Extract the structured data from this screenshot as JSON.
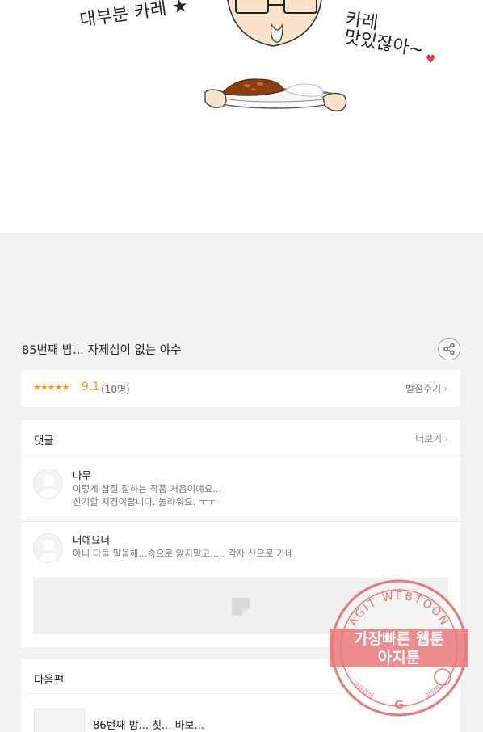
{
  "comic": {
    "bubble_left": "대부분 카레 ★",
    "bubble_right_line1": "카레",
    "bubble_right_line2": "맛있잖아~",
    "heart": "♥"
  },
  "episode": {
    "title": "85번째 밤... 자제심이 없는 야수",
    "share_icon": "share-icon"
  },
  "rating": {
    "stars": "★★★★★",
    "score": "9.1",
    "count": "(10명)",
    "rate_label": "별점주기"
  },
  "comments": {
    "header": "댓글",
    "more_label": "더보기",
    "items": [
      {
        "name": "나무",
        "line1": "이렇게 삽질 잘하는 작품 처음이예요...",
        "line2": "신기할 지경이랍니다. 놀라워요. ㅜㅜ"
      },
      {
        "name": "너예요너",
        "line1": "아니 다들 말을해...속으로 앓지말고..... 각자 산으로 가네",
        "line2": ""
      }
    ]
  },
  "next": {
    "header": "다음편",
    "title": "86번째 밤... 칫... 바보..."
  },
  "watermark": {
    "ring_text": "AGIT WEBTOON",
    "line1": "가장빠른 웹툰",
    "line2": "아지툰",
    "left_small": "구글검색",
    "right_small": "아지툰",
    "g": "G"
  },
  "colors": {
    "accent": "#f19c12",
    "stamp": "#e8787a",
    "heart": "#e03e52"
  }
}
